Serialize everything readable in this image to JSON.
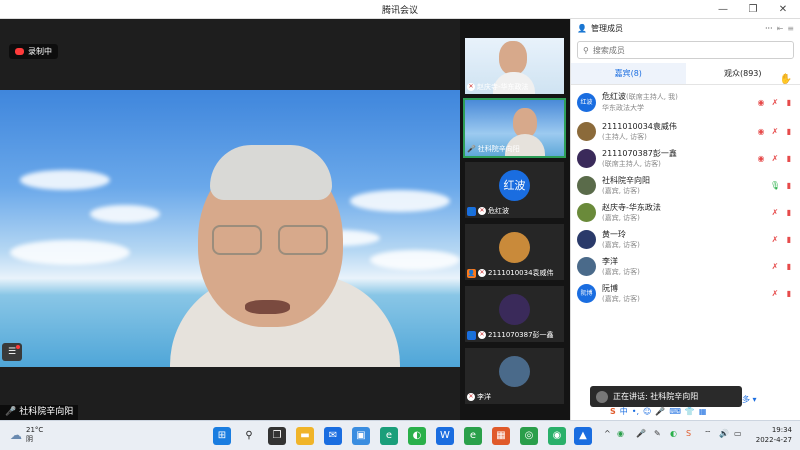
{
  "window": {
    "title": "腾讯会议"
  },
  "main": {
    "recording_label": "录制中",
    "speaker_name": "社科院辛向阳"
  },
  "thumbnails": [
    {
      "name": "赵庆寺-华东政法",
      "type": "video"
    },
    {
      "name": "社科院辛向阳",
      "type": "video",
      "active": true
    },
    {
      "name": "危红波",
      "type": "avatar",
      "avatar_text": "红波",
      "role": "host"
    },
    {
      "name": "2111010034袁威伟",
      "type": "photo",
      "role": "cohost"
    },
    {
      "name": "2111070387彭一鑫",
      "type": "photo",
      "role": "host"
    },
    {
      "name": "李洋",
      "type": "photo"
    }
  ],
  "panel": {
    "title": "管理成员",
    "more": "···",
    "search_placeholder": "搜索成员",
    "tabs": [
      {
        "label": "嘉宾(8)",
        "active": true
      },
      {
        "label": "观众(893)",
        "active": false
      }
    ],
    "members": [
      {
        "name": "危红波",
        "role": "(联席主持人, 我)",
        "sub": "华东政法大学",
        "avatar_text": "红波",
        "avatar_color": "#1a6de0",
        "mic": "muted-red",
        "cam": "off"
      },
      {
        "name": "2111010034袁威伟",
        "sub": "(主持人, 访客)",
        "avatar_text": "",
        "avatar_color": "#8b6a3a",
        "mic": "muted-red",
        "cam": "off"
      },
      {
        "name": "2111070387彭一鑫",
        "sub": "(联席主持人, 访客)",
        "avatar_text": "",
        "avatar_color": "#3a2a5a",
        "mic": "muted-red",
        "cam": "off"
      },
      {
        "name": "社科院辛向阳",
        "sub": "(嘉宾, 访客)",
        "avatar_text": "",
        "avatar_color": "#5a6b4a",
        "mic": "on",
        "cam": "off"
      },
      {
        "name": "赵庆寺-华东政法",
        "sub": "(嘉宾, 访客)",
        "avatar_text": "",
        "avatar_color": "#6a8a3a",
        "mic": "muted",
        "cam": "off"
      },
      {
        "name": "黄一玲",
        "sub": "(嘉宾, 访客)",
        "avatar_text": "",
        "avatar_color": "#2a3a6a",
        "mic": "muted",
        "cam": "off"
      },
      {
        "name": "李洋",
        "sub": "(嘉宾, 访客)",
        "avatar_text": "",
        "avatar_color": "#4a6a8a",
        "mic": "muted",
        "cam": "off"
      },
      {
        "name": "阮博",
        "sub": "(嘉宾, 访客)",
        "avatar_text": "阮博",
        "avatar_color": "#1a6de0",
        "mic": "muted",
        "cam": "off"
      }
    ],
    "speaking_toast": "正在讲话: 社科院辛向阳",
    "more_label": "多"
  },
  "taskbar": {
    "weather_temp": "21°C",
    "weather_desc": "阴",
    "time": "19:34",
    "date": "2022-4-27",
    "ime": "中"
  }
}
